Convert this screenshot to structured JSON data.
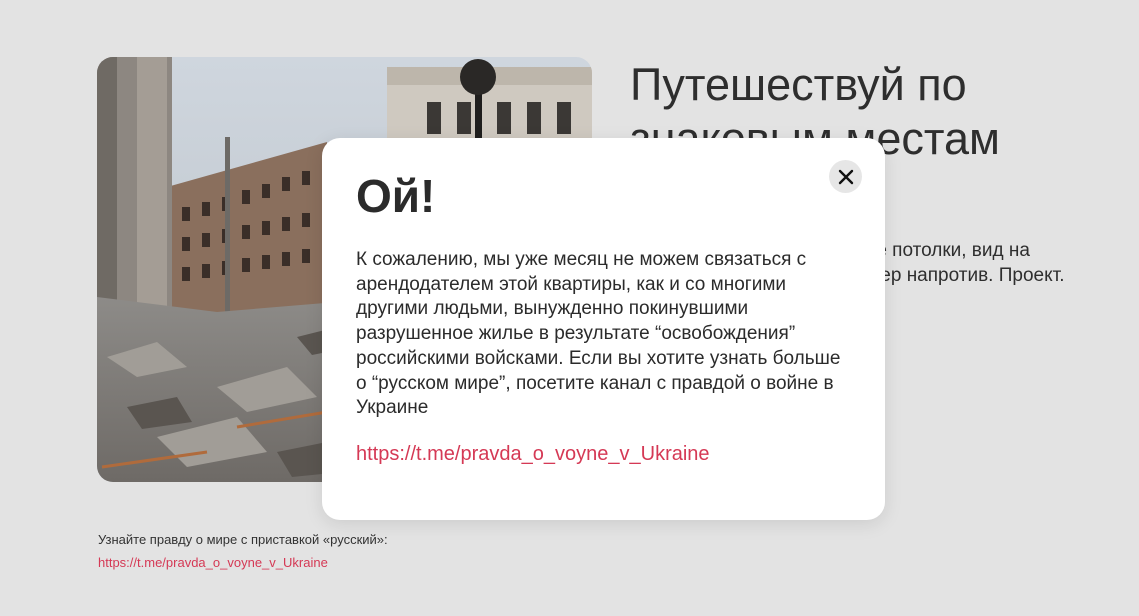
{
  "photo": {
    "alt": "Destroyed city street with ruined buildings and rubble"
  },
  "hero": {
    "headline": "Путешествуй по знаковым местам мира.",
    "description": "Уютное помещение, высокие потолки, вид на центральную площадь и сквер напротив. Проект."
  },
  "modal": {
    "title": "Ой!",
    "body": "К сожалению, мы уже месяц не можем связаться с арендодателем этой квартиры, как и со многими другими людьми, вынужденно покинувшими разрушенное жилье в результате “освобождения” российскими войсками. Если вы хотите узнать больше о “русском мире”, посетите канал с правдой о войне в Украине",
    "link": "https://t.me/pravda_o_voyne_v_Ukraine",
    "close_icon": "close-icon"
  },
  "footer": {
    "text": "Узнайте правду о мире с приставкой «русский»:",
    "link": "https://t.me/pravda_o_voyne_v_Ukraine"
  },
  "colors": {
    "background": "#e3e3e3",
    "accent_link": "#d53955",
    "text": "#2b2b2b",
    "modal_bg": "#ffffff"
  }
}
